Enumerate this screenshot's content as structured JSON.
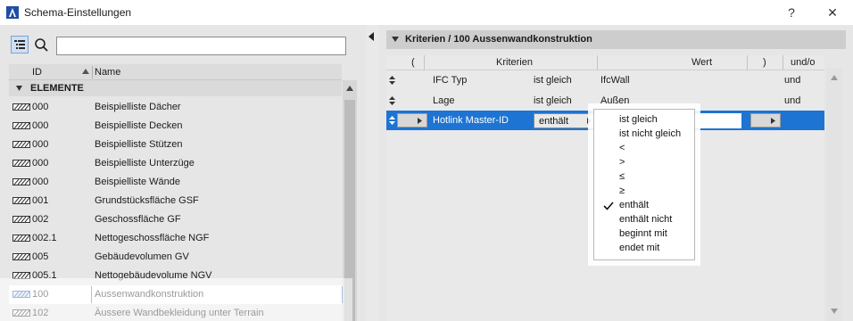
{
  "window": {
    "title": "Schema-Einstellungen",
    "help_label": "?",
    "close_label": "✕"
  },
  "left": {
    "search": {
      "value": "",
      "placeholder": ""
    },
    "columns": {
      "id": "ID",
      "name": "Name"
    },
    "group": {
      "label": "ELEMENTE"
    },
    "rows": [
      {
        "id": "000",
        "name": "Beispielliste Dächer"
      },
      {
        "id": "000",
        "name": "Beispielliste Decken"
      },
      {
        "id": "000",
        "name": "Beispielliste Stützen"
      },
      {
        "id": "000",
        "name": "Beispielliste Unterzüge"
      },
      {
        "id": "000",
        "name": "Beispielliste Wände"
      },
      {
        "id": "001",
        "name": "Grundstücksfläche GSF"
      },
      {
        "id": "002",
        "name": "Geschossfläche GF"
      },
      {
        "id": "002.1",
        "name": "Nettogeschossfläche NGF"
      },
      {
        "id": "005",
        "name": "Gebäudevolumen GV"
      },
      {
        "id": "005.1",
        "name": "Nettogebäudevolume NGV"
      },
      {
        "id": "100",
        "name": "Aussenwandkonstruktion"
      },
      {
        "id": "102",
        "name": "Äussere Wandbekleidung unter Terrain"
      }
    ]
  },
  "right": {
    "section_title": "Kriterien / 100 Aussenwandkonstruktion",
    "columns": {
      "open_paren": "(",
      "criteria": "Kriterien",
      "value": "Wert",
      "close_paren": ")",
      "andor": "und/o"
    },
    "rows": [
      {
        "criterion": "IFC Typ",
        "operator": "ist gleich",
        "value": "IfcWall",
        "andor": "und"
      },
      {
        "criterion": "Lage",
        "operator": "ist gleich",
        "value": "Außen",
        "andor": "und"
      },
      {
        "criterion": "Hotlink Master-ID",
        "operator": "enthält",
        "value": "",
        "andor": ""
      }
    ]
  },
  "dropdown": {
    "items": [
      "ist gleich",
      "ist nicht gleich",
      "<",
      ">",
      "≤",
      "≥",
      "enthält",
      "enthält nicht",
      "beginnt mit",
      "endet mit"
    ],
    "selected": "enthält"
  },
  "colors": {
    "selection_blue": "#1e74d3",
    "panel_bg": "#e6e6e6"
  }
}
